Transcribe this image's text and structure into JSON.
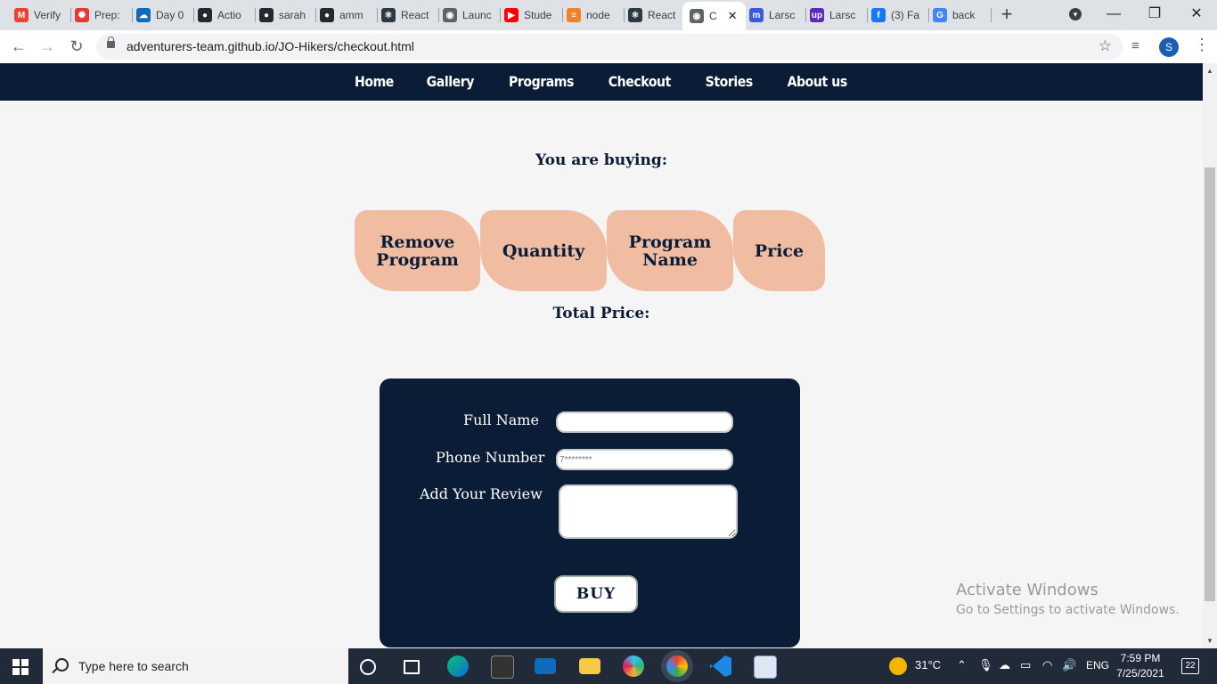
{
  "browser": {
    "tabs": [
      {
        "title": "Verify",
        "favicon_color": "#ea4335",
        "favicon_glyph": "M"
      },
      {
        "title": "Prep:",
        "favicon_color": "#e53935",
        "favicon_glyph": "✺"
      },
      {
        "title": "Day 0",
        "favicon_color": "#0f6cbd",
        "favicon_glyph": "☁"
      },
      {
        "title": "Actio",
        "favicon_color": "#24292f",
        "favicon_glyph": "●"
      },
      {
        "title": "sarah",
        "favicon_color": "#24292f",
        "favicon_glyph": "●"
      },
      {
        "title": "amm",
        "favicon_color": "#24292f",
        "favicon_glyph": "●"
      },
      {
        "title": "React",
        "favicon_color": "#2b3a42",
        "favicon_glyph": "⚛"
      },
      {
        "title": "Launc",
        "favicon_color": "#5f6368",
        "favicon_glyph": "◉"
      },
      {
        "title": "Stude",
        "favicon_color": "#ff0000",
        "favicon_glyph": "▶"
      },
      {
        "title": "node",
        "favicon_color": "#f48024",
        "favicon_glyph": "≡"
      },
      {
        "title": "React",
        "favicon_color": "#2b3a42",
        "favicon_glyph": "⚛"
      },
      {
        "title": "C",
        "favicon_color": "#5f6368",
        "favicon_glyph": "◉",
        "active": true
      },
      {
        "title": "Larsc",
        "favicon_color": "#3b5bdb",
        "favicon_glyph": "m"
      },
      {
        "title": "Larsc",
        "favicon_color": "#5b2bb8",
        "favicon_glyph": "up"
      },
      {
        "title": "(3) Fa",
        "favicon_color": "#1877f2",
        "favicon_glyph": "f"
      },
      {
        "title": "back",
        "favicon_color": "#4285f4",
        "favicon_glyph": "G"
      }
    ],
    "url": "adventurers-team.github.io/JO-Hikers/checkout.html",
    "profile_initial": "S"
  },
  "nav": {
    "items": [
      "Home",
      "Gallery",
      "Programs",
      "Checkout",
      "Stories",
      "About us"
    ]
  },
  "cart": {
    "heading": "You are buying:",
    "columns": [
      {
        "line1": "Remove",
        "line2": "Program"
      },
      {
        "line1": "Quantity",
        "line2": ""
      },
      {
        "line1": "Program",
        "line2": "Name"
      },
      {
        "line1": "Price",
        "line2": ""
      }
    ],
    "total_label": "Total Price:"
  },
  "form": {
    "full_name_label": "Full Name",
    "full_name_value": "",
    "phone_label": "Phone Number",
    "phone_placeholder": "7********",
    "review_label": "Add Your Review",
    "review_value": "",
    "buy_label": "BUY"
  },
  "watermark": {
    "line1": "Activate Windows",
    "line2": "Go to Settings to activate Windows."
  },
  "taskbar": {
    "search_placeholder": "Type here to search",
    "weather": "31°C",
    "language": "ENG",
    "time": "7:59 PM",
    "date": "7/25/2021",
    "notifications": "22"
  }
}
